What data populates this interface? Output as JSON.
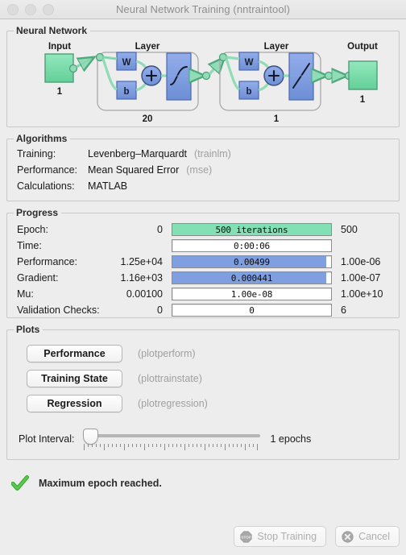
{
  "window": {
    "title": "Neural Network Training (nntraintool)",
    "traffic_lights": [
      "close-button",
      "minimize-button",
      "zoom-button"
    ]
  },
  "neural_network": {
    "legend": "Neural Network",
    "input": {
      "label": "Input",
      "size": "1"
    },
    "layers": [
      {
        "label": "Layer",
        "weight": "W",
        "bias": "b",
        "sum": "+",
        "activation": "sigmoid",
        "size": "20"
      },
      {
        "label": "Layer",
        "weight": "W",
        "bias": "b",
        "sum": "+",
        "activation": "linear",
        "size": "1"
      }
    ],
    "output": {
      "label": "Output",
      "size": "1"
    },
    "colors": {
      "node_green": "#7ddcab",
      "block_blue": "#7f9fe0"
    }
  },
  "algorithms": {
    "legend": "Algorithms",
    "rows": [
      {
        "label": "Training:",
        "value": "Levenberg–Marquardt",
        "fn": "(trainlm)"
      },
      {
        "label": "Performance:",
        "value": "Mean Squared Error",
        "fn": "(mse)"
      },
      {
        "label": "Calculations:",
        "value": "MATLAB",
        "fn": ""
      }
    ]
  },
  "progress": {
    "legend": "Progress",
    "rows": [
      {
        "label": "Epoch:",
        "min": "0",
        "bar_text": "500 iterations",
        "max": "500",
        "fill_percent": 100,
        "color": "green"
      },
      {
        "label": "Time:",
        "min": "",
        "bar_text": "0:00:06",
        "max": "",
        "fill_percent": 0,
        "color": "none"
      },
      {
        "label": "Performance:",
        "min": "1.25e+04",
        "bar_text": "0.00499",
        "max": "1.00e-06",
        "fill_percent": 97,
        "color": "blue"
      },
      {
        "label": "Gradient:",
        "min": "1.16e+03",
        "bar_text": "0.000441",
        "max": "1.00e-07",
        "fill_percent": 97,
        "color": "blue"
      },
      {
        "label": "Mu:",
        "min": "0.00100",
        "bar_text": "1.00e-08",
        "max": "1.00e+10",
        "fill_percent": 0,
        "color": "none"
      },
      {
        "label": "Validation Checks:",
        "min": "0",
        "bar_text": "0",
        "max": "6",
        "fill_percent": 0,
        "color": "none"
      }
    ]
  },
  "plots": {
    "legend": "Plots",
    "buttons": [
      {
        "label": "Performance",
        "fn": "(plotperform)"
      },
      {
        "label": "Training State",
        "fn": "(plottrainstate)"
      },
      {
        "label": "Regression",
        "fn": "(plotregression)"
      }
    ],
    "interval": {
      "label": "Plot Interval:",
      "value": "1 epochs",
      "slider_position_percent": 0
    }
  },
  "status": {
    "icon": "green-checkmark-icon",
    "message": "Maximum epoch reached."
  },
  "footer": {
    "buttons": [
      {
        "label": "Stop Training",
        "icon": "stop-sign-icon",
        "enabled": false
      },
      {
        "label": "Cancel",
        "icon": "x-circle-icon",
        "enabled": false
      }
    ]
  }
}
